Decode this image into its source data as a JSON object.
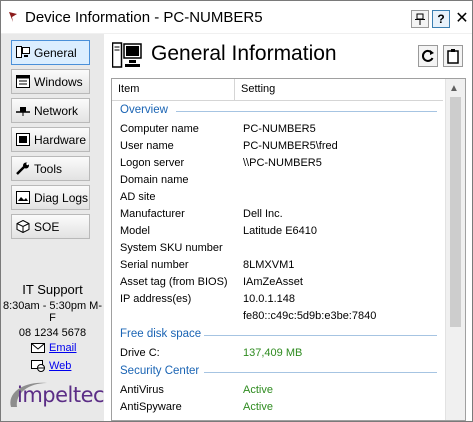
{
  "window": {
    "title": "Device Information - PC-NUMBER5",
    "pin": "⊤",
    "help": "?",
    "close": "✕"
  },
  "colors": {
    "accent": "#4a90d9",
    "section": "#1a64b4",
    "active": "#2e8b1f",
    "brand": "#5b2d86"
  },
  "sidebar": {
    "items": [
      {
        "label": "General",
        "icon": "computer-icon",
        "active": true
      },
      {
        "label": "Windows",
        "icon": "windows-icon",
        "active": false
      },
      {
        "label": "Network",
        "icon": "network-icon",
        "active": false
      },
      {
        "label": "Hardware",
        "icon": "hardware-icon",
        "active": false
      },
      {
        "label": "Tools",
        "icon": "wrench-icon",
        "active": false
      },
      {
        "label": "Diag Logs",
        "icon": "image-icon",
        "active": false
      },
      {
        "label": "SOE",
        "icon": "cube-icon",
        "active": false
      }
    ]
  },
  "support": {
    "title": "IT Support",
    "hours": "8:30am - 5:30pm M-F",
    "phone": "08 1234 5678",
    "email_label": "Email",
    "web_label": "Web"
  },
  "logo": {
    "text": "impeltec"
  },
  "main": {
    "title": "General Information",
    "columns": {
      "item": "Item",
      "setting": "Setting"
    },
    "overview_title": "Overview",
    "overview": [
      {
        "k": "Computer name",
        "v": "PC-NUMBER5"
      },
      {
        "k": "User name",
        "v": "PC-NUMBER5\\fred"
      },
      {
        "k": "Logon server",
        "v": "\\\\PC-NUMBER5"
      },
      {
        "k": "Domain name",
        "v": ""
      },
      {
        "k": "AD site",
        "v": ""
      },
      {
        "k": "Manufacturer",
        "v": "Dell Inc."
      },
      {
        "k": "Model",
        "v": "Latitude E6410"
      },
      {
        "k": "System SKU number",
        "v": ""
      },
      {
        "k": "Serial number",
        "v": "8LMXVM1"
      },
      {
        "k": "Asset tag (from BIOS)",
        "v": "IAmZeAsset"
      },
      {
        "k": "IP address(es)",
        "v": "10.0.1.148"
      },
      {
        "k": "",
        "v": "fe80::c49c:5d9b:e3be:7840"
      }
    ],
    "disk_title": "Free disk space",
    "disk": [
      {
        "k": "Drive C:",
        "v": "137,409 MB"
      }
    ],
    "security_title": "Security Center",
    "security": [
      {
        "k": "AntiVirus",
        "v": "Active"
      },
      {
        "k": "AntiSpyware",
        "v": "Active"
      }
    ]
  }
}
